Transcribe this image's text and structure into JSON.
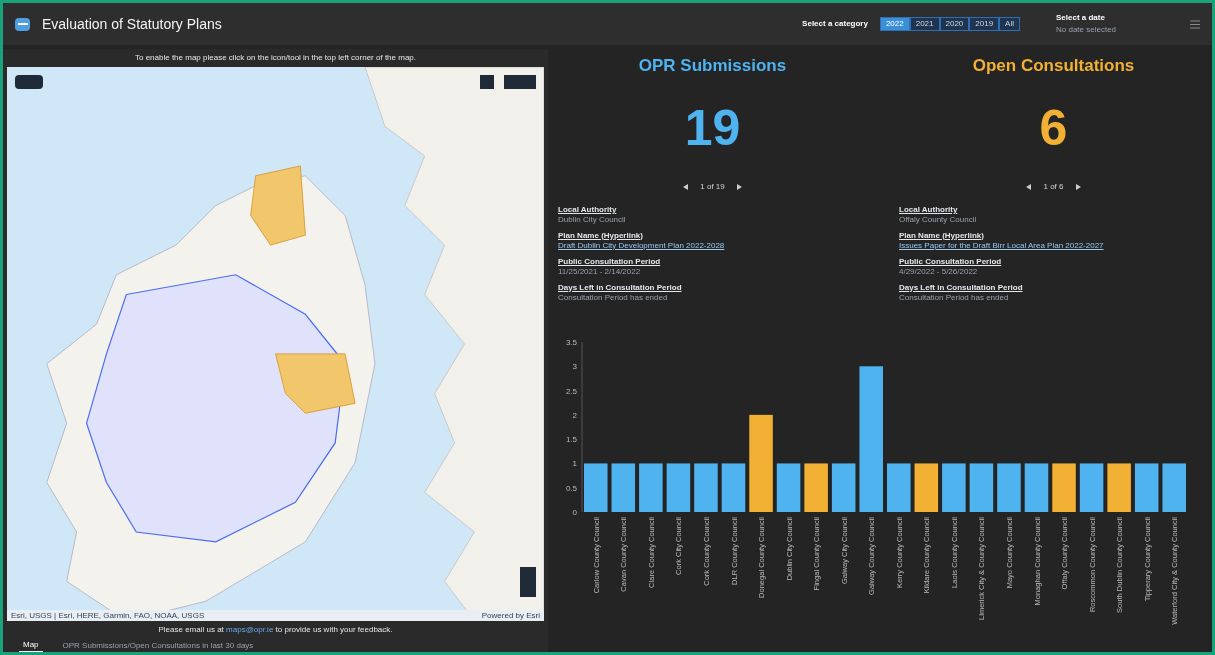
{
  "header": {
    "title": "Evaluation of Statutory Plans",
    "category_label": "Select a category",
    "categories": [
      {
        "label": "2022",
        "selected": true
      },
      {
        "label": "2021",
        "selected": false
      },
      {
        "label": "2020",
        "selected": false
      },
      {
        "label": "2019",
        "selected": false
      },
      {
        "label": "All",
        "selected": false
      }
    ],
    "date_label": "Select a date",
    "date_value": "No date selected"
  },
  "map": {
    "notice": "To enable the map please click on the icon/tool in the top left corner of the map.",
    "attribution": "Esri, USGS | Esri, HERE, Garmin, FAO, NOAA, USGS",
    "powered_by": "Powered by Esri",
    "feedback_before": "Please email us at",
    "feedback_link": "maps@opr.ie",
    "feedback_after": "to provide us with your feedback."
  },
  "bottom_tabs": [
    {
      "label": "Map",
      "selected": true
    },
    {
      "label": "OPR Submissions/Open Consultations in last 30 days",
      "selected": false
    }
  ],
  "panels": [
    {
      "title": "OPR Submissions",
      "count": "19",
      "pager": "1 of 19",
      "color": "#4fb3f0",
      "fields": [
        {
          "label": "Local Authority",
          "value": "Dublin City Council",
          "kind": "text"
        },
        {
          "label": "Plan Name (Hyperlink)",
          "value": "Draft Dublin City Development Plan 2022-2028",
          "kind": "link"
        },
        {
          "label": "Public Consultation Period",
          "value": "11/25/2021 - 2/14/2022",
          "kind": "text"
        },
        {
          "label": "Days Left in Consultation Period",
          "value": "Consultation Period has ended",
          "kind": "text"
        }
      ]
    },
    {
      "title": "Open Consultations",
      "count": "6",
      "pager": "1 of 6",
      "color": "#f2b134",
      "fields": [
        {
          "label": "Local Authority",
          "value": "Offaly County Council",
          "kind": "text"
        },
        {
          "label": "Plan Name (Hyperlink)",
          "value": "Issues Paper for the Draft Birr Local Area Plan 2022-2027",
          "kind": "link"
        },
        {
          "label": "Public Consultation Period",
          "value": "4/29/2022 - 5/26/2022",
          "kind": "text"
        },
        {
          "label": "Days Left in Consultation Period",
          "value": "Consultation Period has ended",
          "kind": "text"
        }
      ]
    }
  ],
  "chart_data": {
    "type": "bar",
    "stacked": true,
    "ylim": [
      0,
      3.5
    ],
    "yticks": [
      0,
      0.5,
      1,
      1.5,
      2,
      2.5,
      3,
      3.5
    ],
    "categories": [
      "Carlow County Council",
      "Cavan County Council",
      "Clare County Council",
      "Cork City Council",
      "Cork County Council",
      "DLR County Council",
      "Donegal County Council",
      "Dublin City Council",
      "Fingal County Council",
      "Galway City Council",
      "Galway County Council",
      "Kerry County Council",
      "Kildare County Council",
      "Laois County Council",
      "Limerick City & County Council",
      "Mayo County Council",
      "Monaghan County Council",
      "Offaly County Council",
      "Roscommon County Council",
      "South Dublin County Council",
      "Tipperary County Council",
      "Waterford City & County Council"
    ],
    "series": [
      {
        "color": "#4fb3f0",
        "values": [
          1,
          1,
          1,
          1,
          1,
          1,
          null,
          1,
          null,
          1,
          3,
          1,
          null,
          1,
          1,
          1,
          1,
          null,
          1,
          null,
          1,
          1
        ]
      },
      {
        "color": "#f2b134",
        "values": [
          null,
          null,
          null,
          null,
          null,
          null,
          2,
          null,
          1,
          null,
          null,
          null,
          1,
          null,
          null,
          null,
          null,
          1,
          null,
          1,
          null,
          null
        ]
      }
    ]
  }
}
